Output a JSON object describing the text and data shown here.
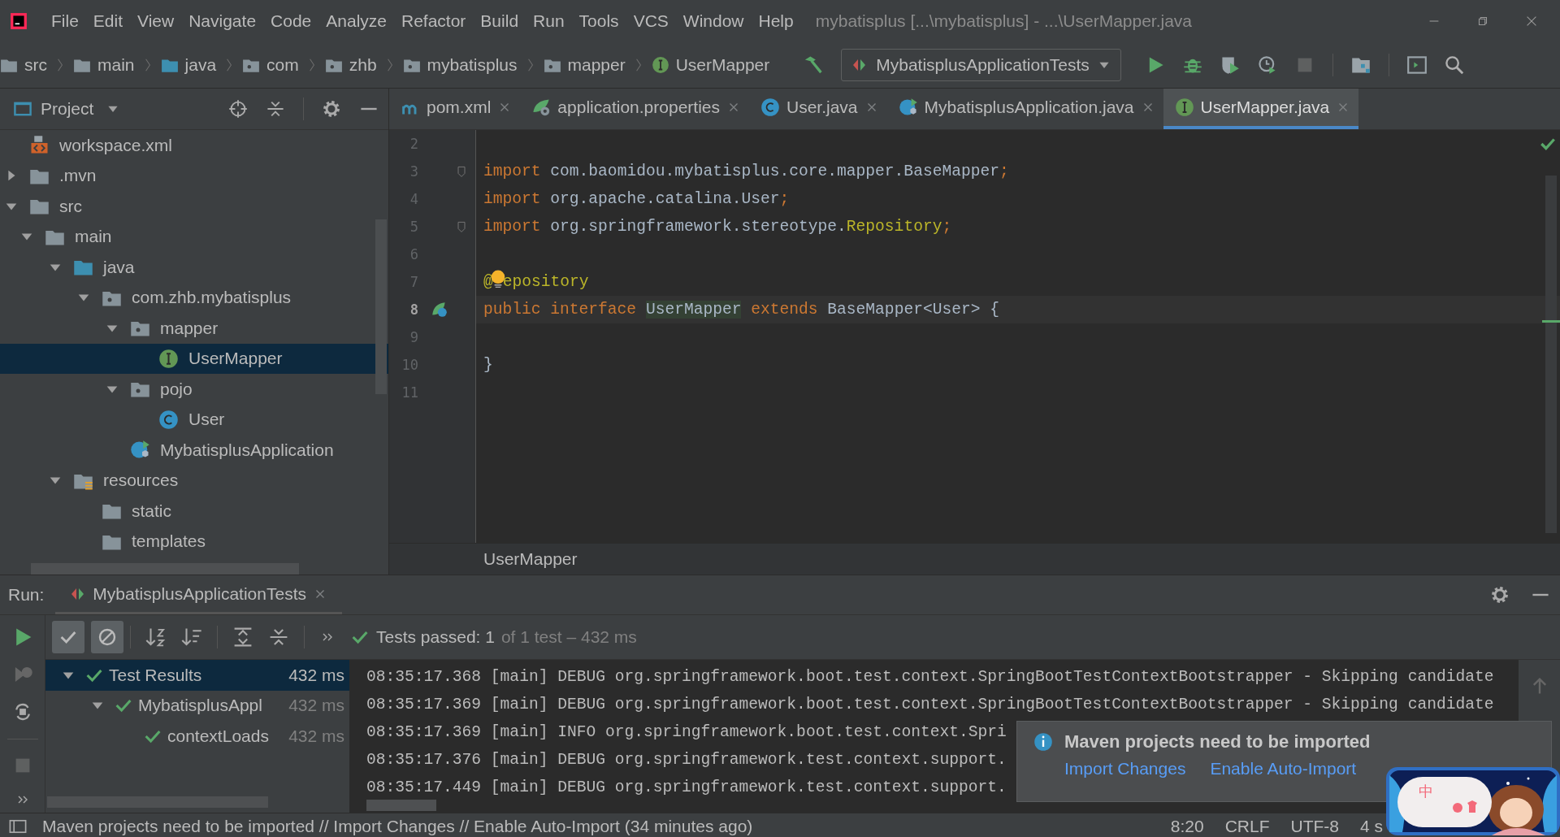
{
  "window": {
    "title": "mybatisplus [...\\mybatisplus] - ...\\UserMapper.java"
  },
  "menu": [
    "File",
    "Edit",
    "View",
    "Navigate",
    "Code",
    "Analyze",
    "Refactor",
    "Build",
    "Run",
    "Tools",
    "VCS",
    "Window",
    "Help"
  ],
  "breadcrumbs": [
    {
      "kind": "folder",
      "label": "src"
    },
    {
      "kind": "folder",
      "label": "main"
    },
    {
      "kind": "source",
      "label": "java"
    },
    {
      "kind": "package",
      "label": "com"
    },
    {
      "kind": "package",
      "label": "zhb"
    },
    {
      "kind": "package",
      "label": "mybatisplus"
    },
    {
      "kind": "package",
      "label": "mapper"
    },
    {
      "kind": "interface",
      "label": "UserMapper"
    }
  ],
  "run_config": {
    "label": "MybatisplusApplicationTests"
  },
  "project": {
    "title": "Project",
    "tree": [
      {
        "kind": "xml",
        "label": "workspace.xml",
        "selected": false
      },
      {
        "kind": "folder",
        "label": ".mvn",
        "expanded": false,
        "selected": false
      },
      {
        "kind": "folder",
        "label": "src",
        "expanded": true,
        "selected": false,
        "children": [
          {
            "kind": "folder",
            "label": "main",
            "expanded": true,
            "selected": false,
            "children": [
              {
                "kind": "source",
                "label": "java",
                "expanded": true,
                "selected": false,
                "children": [
                  {
                    "kind": "package",
                    "label": "com.zhb.mybatisplus",
                    "expanded": true,
                    "selected": false,
                    "children": [
                      {
                        "kind": "package",
                        "label": "mapper",
                        "expanded": true,
                        "selected": false,
                        "children": [
                          {
                            "kind": "interface",
                            "label": "UserMapper",
                            "selected": true
                          }
                        ]
                      },
                      {
                        "kind": "package",
                        "label": "pojo",
                        "expanded": true,
                        "selected": false,
                        "children": [
                          {
                            "kind": "class",
                            "label": "User",
                            "selected": false
                          }
                        ]
                      },
                      {
                        "kind": "app",
                        "label": "MybatisplusApplication",
                        "selected": false
                      }
                    ]
                  }
                ]
              },
              {
                "kind": "resources",
                "label": "resources",
                "expanded": true,
                "selected": false,
                "children": [
                  {
                    "kind": "folder",
                    "label": "static",
                    "selected": false
                  },
                  {
                    "kind": "folder",
                    "label": "templates",
                    "selected": false
                  }
                ]
              }
            ]
          }
        ]
      }
    ]
  },
  "editor_tabs": [
    {
      "kind": "maven",
      "label": "pom.xml",
      "selected": false
    },
    {
      "kind": "properties",
      "label": "application.properties",
      "selected": false
    },
    {
      "kind": "class",
      "label": "User.java",
      "selected": false
    },
    {
      "kind": "app",
      "label": "MybatisplusApplication.java",
      "selected": false
    },
    {
      "kind": "interface",
      "label": "UserMapper.java",
      "selected": true
    }
  ],
  "editor": {
    "lines": [
      {
        "number": "2",
        "current": false,
        "intention": false,
        "kind": "plain"
      },
      {
        "number": "3",
        "current": false,
        "intention": false,
        "kind": "fold",
        "tokens": [
          {
            "kind": "kw",
            "text": "import"
          },
          {
            "kind": "plain",
            "text": " com.baomidou.mybatisplus.core.mapper.BaseMapper"
          },
          {
            "kind": "kw",
            "text": ";"
          }
        ]
      },
      {
        "number": "4",
        "current": false,
        "intention": false,
        "kind": "plain",
        "tokens": [
          {
            "kind": "kw",
            "text": "import"
          },
          {
            "kind": "plain",
            "text": " org.apache.catalina.User"
          },
          {
            "kind": "kw",
            "text": ";"
          }
        ]
      },
      {
        "number": "5",
        "current": false,
        "intention": false,
        "kind": "fold",
        "tokens": [
          {
            "kind": "kw",
            "text": "import"
          },
          {
            "kind": "plain",
            "text": " org.springframework.stereotype."
          },
          {
            "kind": "ann",
            "text": "Repository"
          },
          {
            "kind": "kw",
            "text": ";"
          }
        ]
      },
      {
        "number": "6",
        "current": false,
        "intention": false,
        "kind": "plain"
      },
      {
        "number": "7",
        "current": false,
        "intention": true,
        "kind": "plain",
        "tokens": [
          {
            "kind": "ann",
            "text": "@"
          },
          {
            "kind": "ann",
            "text": "epository"
          }
        ]
      },
      {
        "number": "8",
        "current": true,
        "intention": false,
        "kind": "bean",
        "tokens": [
          {
            "kind": "kw",
            "text": "public interface "
          },
          {
            "kind": "match",
            "text": "UserMapper"
          },
          {
            "kind": "kw",
            "text": " extends"
          },
          {
            "kind": "plain",
            "text": " BaseMapper<User> {"
          }
        ]
      },
      {
        "number": "9",
        "current": false,
        "intention": false,
        "kind": "plain"
      },
      {
        "number": "10",
        "current": false,
        "intention": false,
        "kind": "plain",
        "tokens": [
          {
            "kind": "plain",
            "text": "}"
          }
        ]
      },
      {
        "number": "11",
        "current": false,
        "intention": false,
        "kind": "plain"
      }
    ],
    "breadcrumb": "UserMapper"
  },
  "run": {
    "label": "Run:",
    "tab": {
      "label": "MybatisplusApplicationTests"
    },
    "filters": [
      {
        "kind": "passed",
        "on": true
      },
      {
        "kind": "ignored",
        "on": true
      }
    ],
    "summary": {
      "status": "Tests passed: 1",
      "detail": "of 1 test – 432 ms"
    },
    "tests": [
      {
        "label": "Test Results",
        "time": "432 ms",
        "expanded": true,
        "selected": true,
        "children": [
          {
            "label": "MybatisplusAppl",
            "time": "432 ms",
            "expanded": true,
            "selected": false,
            "children": [
              {
                "label": "contextLoads",
                "time": "432 ms",
                "selected": false
              }
            ]
          }
        ]
      }
    ],
    "console": [
      "08:35:17.368 [main] DEBUG org.springframework.boot.test.context.SpringBootTestContextBootstrapper - Skipping candidate",
      "08:35:17.369 [main] DEBUG org.springframework.boot.test.context.SpringBootTestContextBootstrapper - Skipping candidate",
      "08:35:17.369 [main] INFO org.springframework.boot.test.context.Spri",
      "08:35:17.376 [main] DEBUG org.springframework.test.context.support.",
      "08:35:17.449 [main] DEBUG org.springframework.test.context.support."
    ]
  },
  "notification": {
    "title": "Maven projects need to be imported",
    "actions": [
      "Import Changes",
      "Enable Auto-Import"
    ]
  },
  "status_bar": {
    "message": "Maven projects need to be imported // Import Changes // Enable Auto-Import (34 minutes ago)",
    "items": [
      "8:20",
      "CRLF",
      "UTF-8",
      "4 s"
    ]
  },
  "ime": {
    "label": "中"
  }
}
